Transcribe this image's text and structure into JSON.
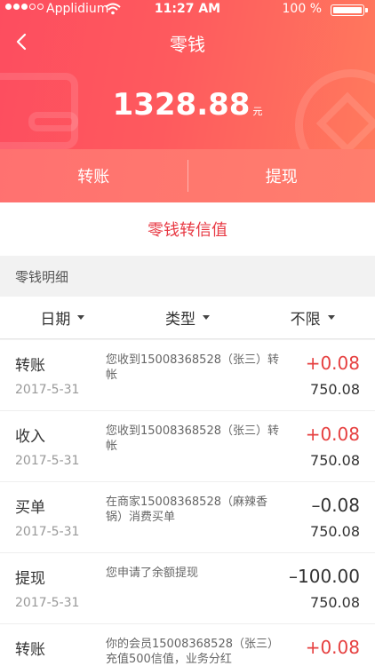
{
  "status_bar": {
    "carrier": "Applidium",
    "time": "11:27 AM",
    "battery": "100 %"
  },
  "nav": {
    "title": "零钱"
  },
  "balance": {
    "amount": "1328.88",
    "unit": "元"
  },
  "actions": {
    "transfer": "转账",
    "withdraw": "提现"
  },
  "promo": {
    "label": "零钱转信值"
  },
  "section": {
    "title": "零钱明细"
  },
  "filters": [
    {
      "label": "日期"
    },
    {
      "label": "类型"
    },
    {
      "label": "不限"
    }
  ],
  "transactions": [
    {
      "type": "转账",
      "date": "2017-5-31",
      "desc": "您收到15008368528（张三）转帐",
      "amount": "+0.08",
      "balance": "750.08",
      "direction": "positive"
    },
    {
      "type": "收入",
      "date": "2017-5-31",
      "desc": "您收到15008368528（张三）转帐",
      "amount": "+0.08",
      "balance": "750.08",
      "direction": "positive"
    },
    {
      "type": "买单",
      "date": "2017-5-31",
      "desc": "在商家15008368528（麻辣香锅）消费买单",
      "amount": "–0.08",
      "balance": "750.08",
      "direction": "negative"
    },
    {
      "type": "提现",
      "date": "2017-5-31",
      "desc": "您申请了余额提现",
      "amount": "–100.00",
      "balance": "750.08",
      "direction": "negative"
    },
    {
      "type": "转账",
      "date": "",
      "desc": "你的会员15008368528（张三）充值500信值，业务分红",
      "amount": "+0.08",
      "balance": "",
      "direction": "positive"
    }
  ]
}
